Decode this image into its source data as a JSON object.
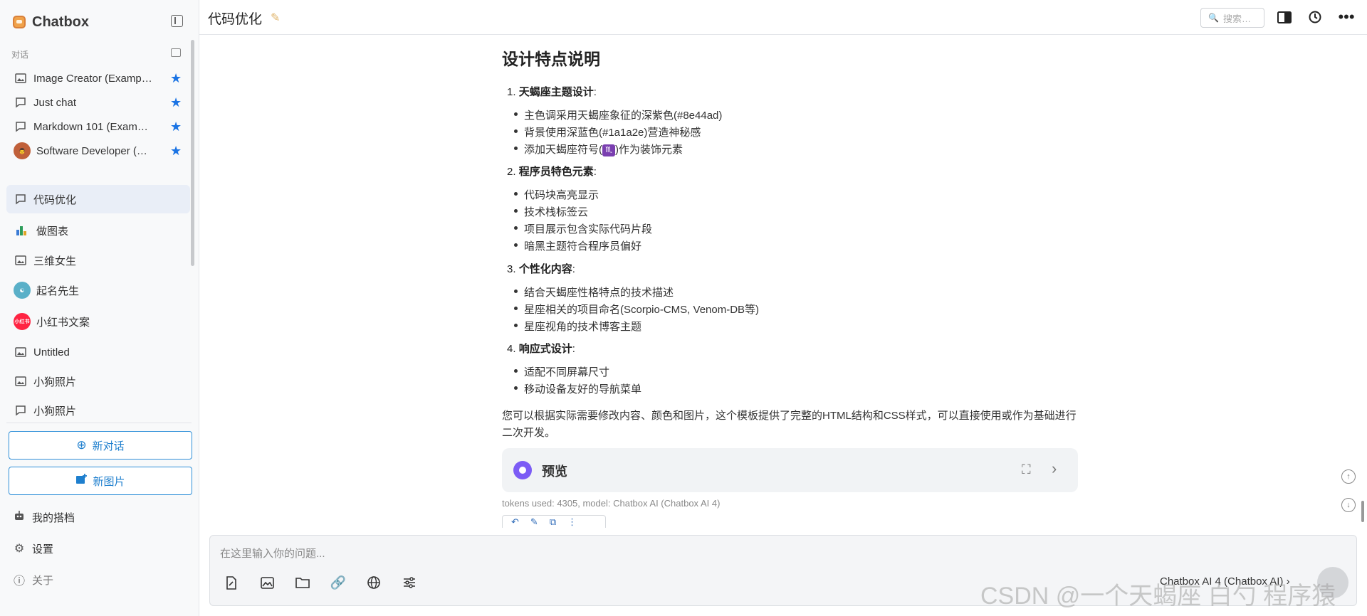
{
  "app": {
    "name": "Chatbox"
  },
  "sidebar": {
    "section_label": "对话",
    "items": [
      {
        "label": "Image Creator (Examp…",
        "icon": "image-icon",
        "starred": true
      },
      {
        "label": "Just chat",
        "icon": "chat-bubble-icon",
        "starred": true
      },
      {
        "label": "Markdown 101 (Exam…",
        "icon": "chat-bubble-icon",
        "starred": true
      },
      {
        "label": "Software Developer (…",
        "icon": "developer-avatar-icon",
        "starred": true
      },
      {
        "label": "代码优化",
        "icon": "chat-bubble-icon",
        "active": true
      },
      {
        "label": "做图表",
        "icon": "chart-avatar-icon"
      },
      {
        "label": "三维女生",
        "icon": "image-icon"
      },
      {
        "label": "起名先生",
        "icon": "yin-yang-avatar-icon"
      },
      {
        "label": "小红书文案",
        "icon": "xiaohongshu-avatar-icon",
        "avatar_text": "小红书"
      },
      {
        "label": "Untitled",
        "icon": "image-icon"
      },
      {
        "label": "小狗照片",
        "icon": "image-icon"
      },
      {
        "label": "小狗照片",
        "icon": "chat-bubble-icon"
      }
    ],
    "new_chat": "新对话",
    "new_image": "新图片",
    "my_copilots": "我的搭档",
    "settings": "设置",
    "about": "关于"
  },
  "topbar": {
    "title": "代码优化",
    "search_placeholder": "搜索…"
  },
  "message": {
    "heading": "设计特点说明",
    "sections": [
      {
        "num": "1.",
        "title": "天蝎座主题设计",
        "colon": ":",
        "bullets": [
          "主色调采用天蝎座象征的深紫色(#8e44ad)",
          "背景使用深蓝色(#1a1a2e)营造神秘感"
        ],
        "symbol_bullet": {
          "before": "添加天蝎座符号(",
          "symbol": "♏",
          "after": ")作为装饰元素"
        }
      },
      {
        "num": "2.",
        "title": "程序员特色元素",
        "colon": ":",
        "bullets": [
          "代码块高亮显示",
          "技术栈标签云",
          "项目展示包含实际代码片段",
          "暗黑主题符合程序员偏好"
        ]
      },
      {
        "num": "3.",
        "title": "个性化内容",
        "colon": ":",
        "bullets": [
          "结合天蝎座性格特点的技术描述",
          "星座相关的项目命名(Scorpio-CMS, Venom-DB等)",
          "星座视角的技术博客主题"
        ]
      },
      {
        "num": "4.",
        "title": "响应式设计",
        "colon": ":",
        "bullets": [
          "适配不同屏幕尺寸",
          "移动设备友好的导航菜单"
        ]
      }
    ],
    "closing": "您可以根据实际需要修改内容、颜色和图片，这个模板提供了完整的HTML结构和CSS样式，可以直接使用或作为基础进行二次开发。",
    "preview_label": "预览",
    "tokens": "tokens used: 4305, model: Chatbox AI (Chatbox AI 4)"
  },
  "input": {
    "placeholder": "在这里输入你的问题...",
    "model": "Chatbox AI 4 (Chatbox AI)"
  },
  "watermark": "CSDN @一个天蝎座 白勺 程序猿",
  "colors": {
    "accent": "#1b74e4",
    "scorpio_purple": "#7a3fb0",
    "preview_play": "#7c5cf5"
  }
}
